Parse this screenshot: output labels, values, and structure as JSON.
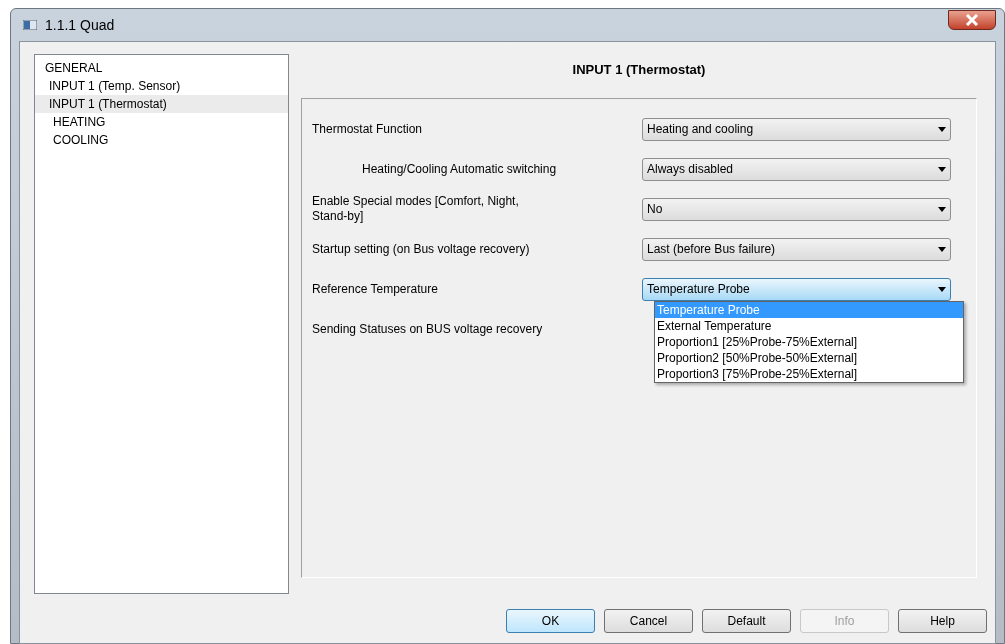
{
  "window": {
    "title": "1.1.1 Quad"
  },
  "sidebar": {
    "items": [
      {
        "label": "GENERAL",
        "selected": false,
        "children": [
          {
            "label": "INPUT 1 (Temp. Sensor)",
            "selected": false
          },
          {
            "label": "INPUT 1 (Thermostat)",
            "selected": true,
            "children": [
              {
                "label": "HEATING",
                "selected": false
              },
              {
                "label": "COOLING",
                "selected": false
              }
            ]
          }
        ]
      }
    ]
  },
  "panel": {
    "title": "INPUT 1 (Thermostat)",
    "parameters": [
      {
        "label": "Thermostat Function",
        "indented": false,
        "value": "Heating and cooling",
        "expanded": false
      },
      {
        "label": "Heating/Cooling Automatic switching",
        "indented": true,
        "value": "Always disabled",
        "expanded": false
      },
      {
        "label": "Enable Special modes [Comfort, Night, Stand-by]",
        "indented": false,
        "value": "No",
        "expanded": false
      },
      {
        "label": "Startup setting (on Bus voltage recovery)",
        "indented": false,
        "value": "Last (before Bus failure)",
        "expanded": false
      },
      {
        "label": "Reference Temperature",
        "indented": false,
        "value": "Temperature Probe",
        "expanded": true,
        "options": [
          {
            "label": "Temperature Probe",
            "selected": true
          },
          {
            "label": "External Temperature",
            "selected": false
          },
          {
            "label": "Proportion1 [25%Probe-75%External]",
            "selected": false
          },
          {
            "label": "Proportion2 [50%Probe-50%External]",
            "selected": false
          },
          {
            "label": "Proportion3 [75%Probe-25%External]",
            "selected": false
          }
        ]
      },
      {
        "label": "Sending Statuses on BUS voltage recovery",
        "indented": false
      }
    ]
  },
  "buttons": [
    {
      "label": "OK",
      "default": true,
      "disabled": false
    },
    {
      "label": "Cancel",
      "default": false,
      "disabled": false
    },
    {
      "label": "Default",
      "default": false,
      "disabled": false
    },
    {
      "label": "Info",
      "default": false,
      "disabled": true
    },
    {
      "label": "Help",
      "default": false,
      "disabled": false
    }
  ]
}
